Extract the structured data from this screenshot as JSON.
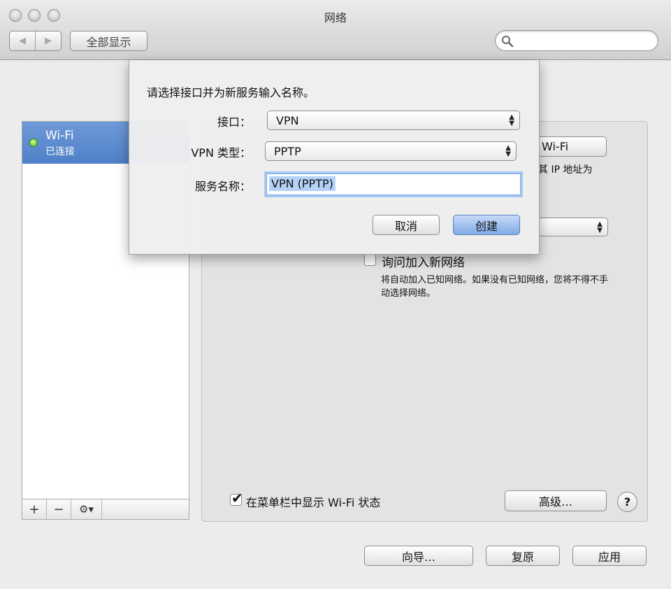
{
  "window": {
    "title": "网络"
  },
  "toolbar": {
    "show_all": "全部显示",
    "back": "◀",
    "forward": "▶"
  },
  "sidebar": {
    "items": [
      {
        "name": "Wi-Fi",
        "status": "已连接"
      }
    ],
    "add": "+",
    "remove": "−",
    "gear": "⚙▾"
  },
  "panel": {
    "wifi_button": "Wi-Fi",
    "ip_text": "其 IP 地址为",
    "ask_join_label": "询问加入新网络",
    "ask_join_desc": "将自动加入已知网络。如果没有已知网络，您将不得不手动选择网络。",
    "show_in_menubar": "在菜单栏中显示 Wi-Fi 状态",
    "advanced": "高级…",
    "help": "?"
  },
  "footer": {
    "assistant": "向导…",
    "revert": "复原",
    "apply": "应用"
  },
  "sheet": {
    "prompt": "请选择接口并为新服务输入名称。",
    "interface_label": "接口：",
    "interface_value": "VPN",
    "vpn_type_label": "VPN 类型：",
    "vpn_type_value": "PPTP",
    "service_name_label": "服务名称：",
    "service_name_value": "VPN (PPTP)",
    "cancel": "取消",
    "create": "创建"
  }
}
